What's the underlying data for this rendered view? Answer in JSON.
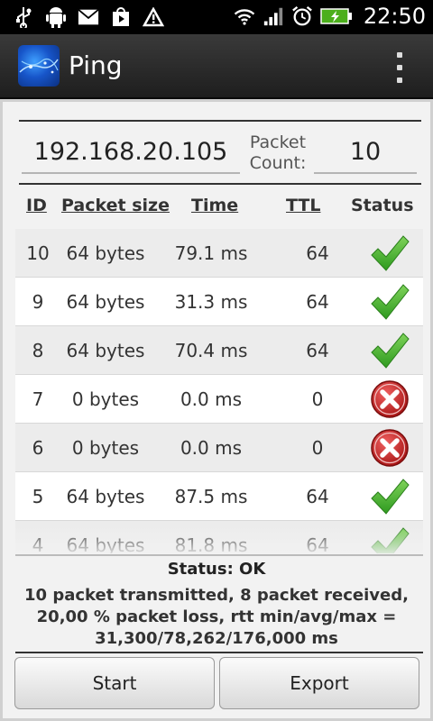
{
  "status_bar": {
    "time": "22:50",
    "icons": [
      "usb-icon",
      "android-debug-icon",
      "mail-icon",
      "play-store-icon",
      "warning-icon",
      "wifi-icon",
      "signal-icon",
      "alarm-icon",
      "battery-charging-icon"
    ]
  },
  "app": {
    "title": "Ping",
    "icon": "app-globe-icon",
    "menu_icon": "overflow-menu-icon"
  },
  "form": {
    "host": "192.168.20.105",
    "packet_count_label": "Packet Count:",
    "packet_count": "10"
  },
  "table": {
    "headers": {
      "id": "ID",
      "size": "Packet size",
      "time": "Time",
      "ttl": "TTL",
      "status": "Status"
    },
    "rows": [
      {
        "id": "10",
        "size": "64 bytes",
        "time": "79.1 ms",
        "ttl": "64",
        "status": "ok"
      },
      {
        "id": "9",
        "size": "64 bytes",
        "time": "31.3 ms",
        "ttl": "64",
        "status": "ok"
      },
      {
        "id": "8",
        "size": "64 bytes",
        "time": "70.4 ms",
        "ttl": "64",
        "status": "ok"
      },
      {
        "id": "7",
        "size": "0 bytes",
        "time": "0.0 ms",
        "ttl": "0",
        "status": "error"
      },
      {
        "id": "6",
        "size": "0 bytes",
        "time": "0.0 ms",
        "ttl": "0",
        "status": "error"
      },
      {
        "id": "5",
        "size": "64 bytes",
        "time": "87.5 ms",
        "ttl": "64",
        "status": "ok"
      },
      {
        "id": "4",
        "size": "64 bytes",
        "time": "81.8 ms",
        "ttl": "64",
        "status": "ok"
      }
    ]
  },
  "result": {
    "status": "Status: OK",
    "summary": "10 packet transmitted, 8 packet received, 20,00 % packet loss, rtt min/avg/max = 31,300/78,262/176,000 ms"
  },
  "buttons": {
    "start": "Start",
    "export": "Export"
  },
  "colors": {
    "ok": "#3dae2b",
    "error": "#c62828",
    "actionbar": "#2b2b2b"
  }
}
